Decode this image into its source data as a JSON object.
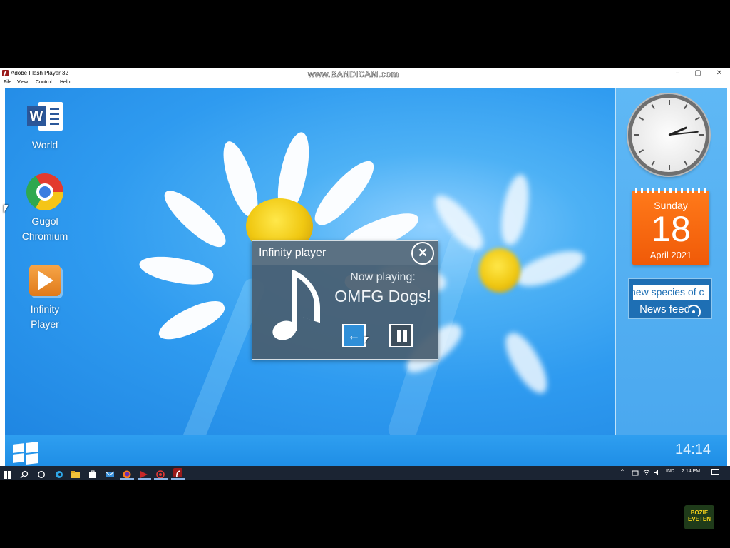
{
  "window": {
    "title": "Adobe Flash Player 32",
    "watermark": "www.BANDICAM.com",
    "controls": {
      "minimize": "–",
      "maximize": "▢",
      "close": "✕"
    }
  },
  "menubar": {
    "items": [
      "File",
      "View",
      "Control",
      "Help"
    ]
  },
  "desktop": {
    "icons": [
      {
        "label_line1": "World",
        "label_line2": "",
        "icon": "word-icon"
      },
      {
        "label_line1": "Gugol",
        "label_line2": "Chromium",
        "icon": "chrome-icon"
      },
      {
        "label_line1": "Infinity",
        "label_line2": "Player",
        "icon": "infinity-player-icon"
      }
    ]
  },
  "widgets": {
    "clock": {
      "hour": 2,
      "minute": 14
    },
    "calendar": {
      "weekday": "Sunday",
      "day": "18",
      "month_year": "April 2021"
    },
    "newsfeed": {
      "ticker": "new species of c",
      "label": "News feed",
      "icon": "rss-icon"
    }
  },
  "player": {
    "title": "Infinity player",
    "close_glyph": "✕",
    "now_playing_label": "Now playing:",
    "track": "OMFG Dogs!",
    "back_glyph": "←",
    "icons": [
      "music-note-icon",
      "back-arrow-icon",
      "pause-icon"
    ]
  },
  "stage_bar": {
    "time": "14:14",
    "logo_icon": "windows-logo-icon"
  },
  "taskbar": {
    "language": "IND",
    "time": "2:14 PM",
    "items": [
      "start-icon",
      "search-icon",
      "cortana-icon",
      "edge-icon",
      "file-explorer-icon",
      "store-icon",
      "mail-icon",
      "firefox-icon",
      "app-icon",
      "bandicam-icon",
      "flash-player-icon"
    ]
  },
  "channel_logo": {
    "line1": "BOZIE",
    "line2": "EVETEN"
  },
  "colors": {
    "wallpaper": "#2f9bf0",
    "calendar": "#f05a08",
    "player_bg": "#485e70",
    "accent_button": "#2f8fd8",
    "taskbar": "#1b2433"
  }
}
